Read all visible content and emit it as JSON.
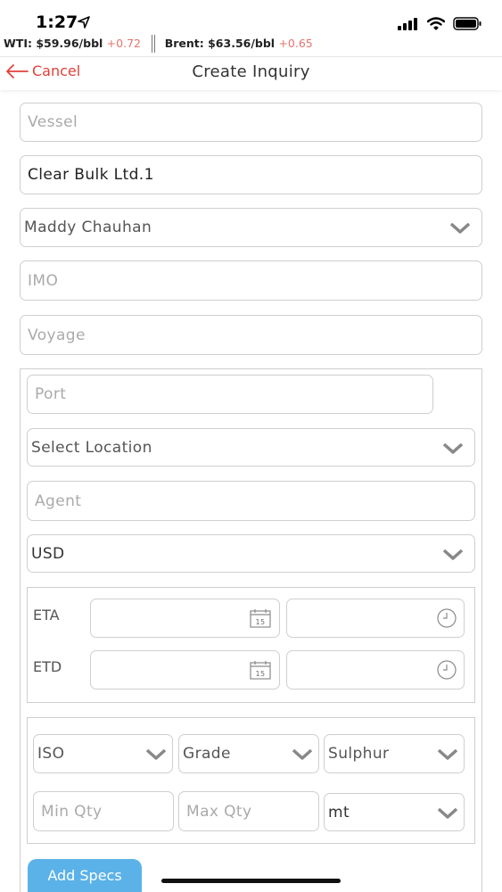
{
  "status": {
    "time": "1:27"
  },
  "ticker": {
    "wti_label": "WTI: $59.96/bbl",
    "wti_change": "+0.72",
    "brent_label": "Brent: $63.56/bbl",
    "brent_change": "+0.65"
  },
  "nav": {
    "cancel_label": "Cancel",
    "title": "Create Inquiry"
  },
  "form": {
    "vessel_placeholder": "Vessel",
    "company_value": "Clear Bulk Ltd.1",
    "contact_value": "Maddy Chauhan",
    "imo_placeholder": "IMO",
    "voyage_placeholder": "Voyage",
    "port_placeholder": "Port",
    "location_value": "Select Location",
    "agent_placeholder": "Agent",
    "currency_value": "USD",
    "eta_label": "ETA",
    "etd_label": "ETD",
    "calendar_day": "15",
    "iso_value": "ISO",
    "grade_value": "Grade",
    "sulphur_value": "Sulphur",
    "min_qty_placeholder": "Min Qty",
    "max_qty_placeholder": "Max Qty",
    "unit_value": "mt",
    "add_specs_label": "Add Specs"
  },
  "colors": {
    "accent_red": "#e0403a",
    "button_blue": "#5bb2e8",
    "change_up": "#e5746c"
  }
}
